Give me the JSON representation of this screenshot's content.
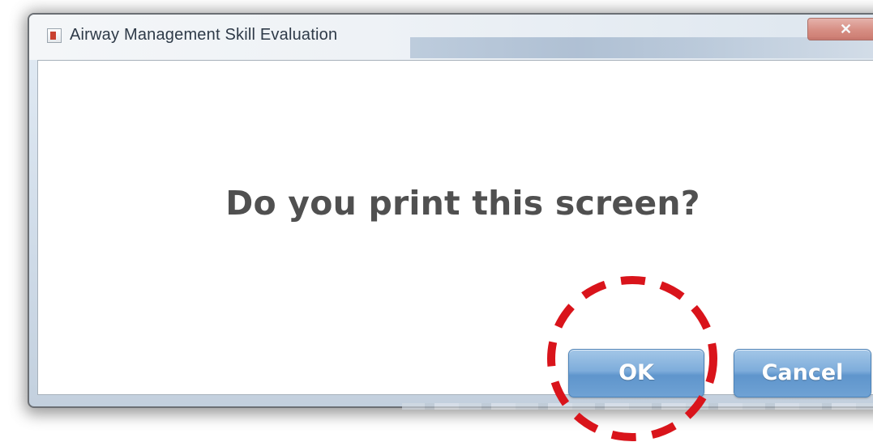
{
  "window": {
    "title": "Airway Management Skill Evaluation",
    "close_glyph": "✕"
  },
  "dialog": {
    "message": "Do you print this screen?",
    "buttons": {
      "ok_label": "OK",
      "cancel_label": "Cancel"
    }
  },
  "annotation": {
    "highlight_target": "OK",
    "highlight_color": "#d9141b",
    "highlight_style": "dashed"
  },
  "colors": {
    "button_blue": "#6fa2d4",
    "message_text": "#505050",
    "title_text": "#2e3a48"
  },
  "icons": {
    "app": "app-icon",
    "close": "close-icon"
  }
}
